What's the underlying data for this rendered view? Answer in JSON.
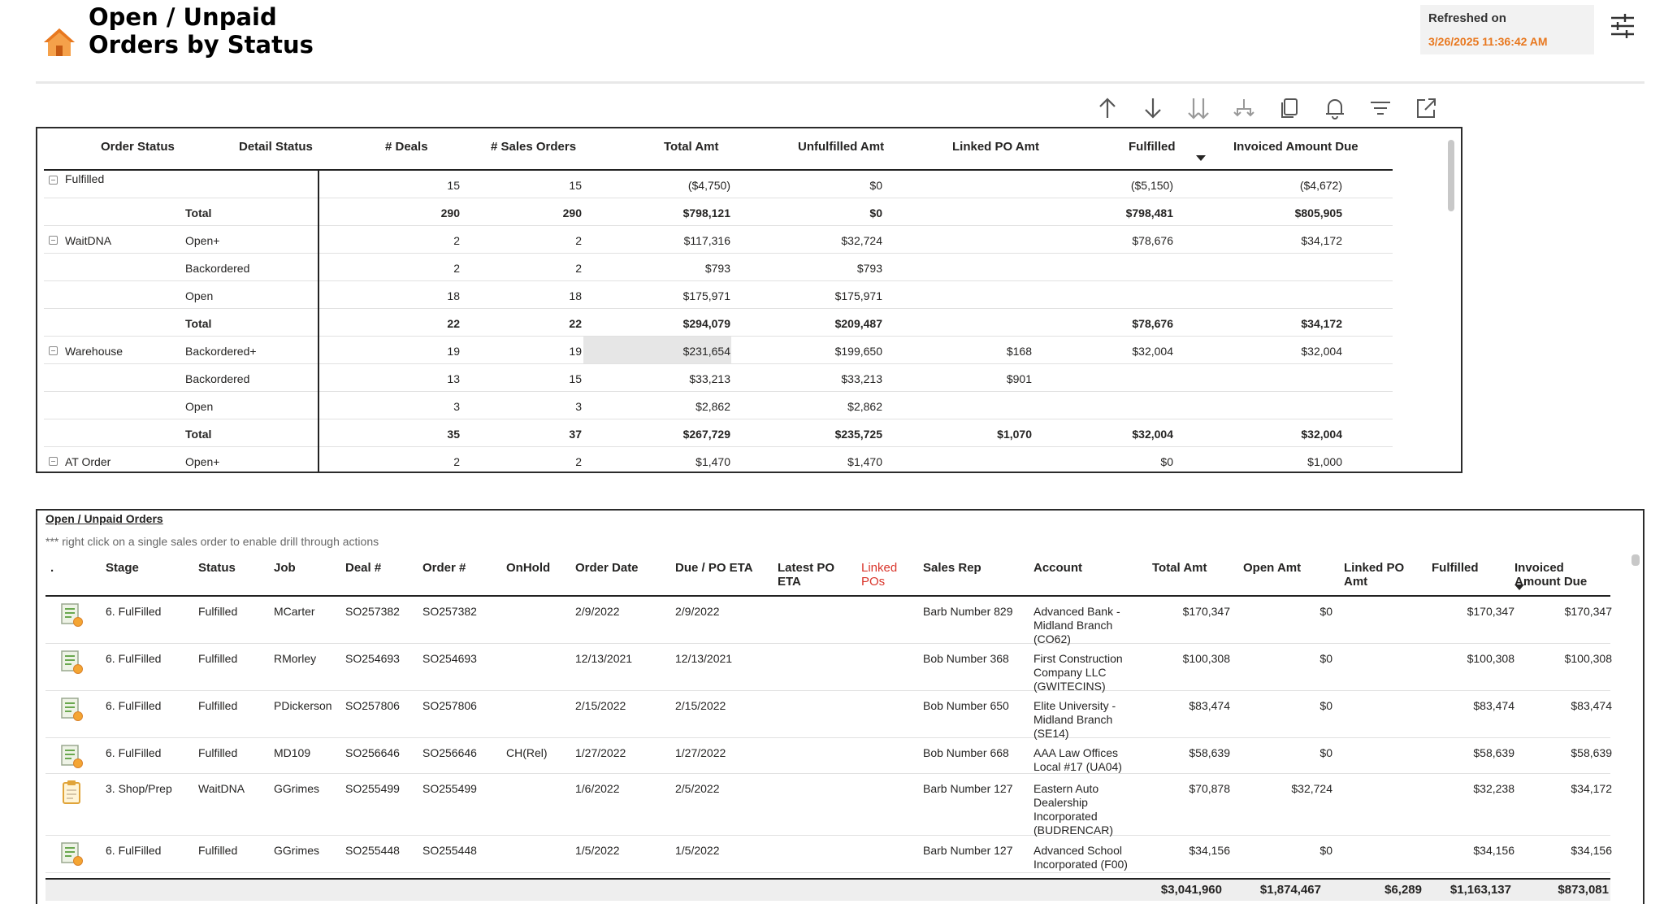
{
  "header": {
    "title_line1": "Open / Unpaid",
    "title_line2": "Orders by Status",
    "refreshed_label": "Refreshed on",
    "refreshed_value": "3/26/2025 11:36:42 AM",
    "accent_color": "#e8781f"
  },
  "toolbar": {
    "icons": [
      "sort-ascending-icon",
      "sort-descending-icon",
      "expand-all-icon",
      "drill-hierarchy-icon",
      "copy-icon",
      "bell-icon",
      "filter-icon",
      "focus-mode-icon"
    ]
  },
  "matrix": {
    "headers": [
      "Order Status",
      "Detail Status",
      "# Deals",
      "# Sales Orders",
      "Total Amt",
      "Unfulfilled Amt",
      "Linked PO Amt",
      "Fulfilled",
      "Invoiced Amount Due"
    ],
    "rows": [
      {
        "group": "Fulfilled",
        "detail": "",
        "deals": "15",
        "so": "15",
        "total": "($4,750)",
        "unfulfilled": "$0",
        "linked": "",
        "fulfilled": "($5,150)",
        "invoiced": "($4,672)",
        "bold": false
      },
      {
        "group": "",
        "detail": "Total",
        "deals": "290",
        "so": "290",
        "total": "$798,121",
        "unfulfilled": "$0",
        "linked": "",
        "fulfilled": "$798,481",
        "invoiced": "$805,905",
        "bold": true
      },
      {
        "group": "WaitDNA",
        "detail": "Open+",
        "deals": "2",
        "so": "2",
        "total": "$117,316",
        "unfulfilled": "$32,724",
        "linked": "",
        "fulfilled": "$78,676",
        "invoiced": "$34,172",
        "bold": false
      },
      {
        "group": "",
        "detail": "Backordered",
        "deals": "2",
        "so": "2",
        "total": "$793",
        "unfulfilled": "$793",
        "linked": "",
        "fulfilled": "",
        "invoiced": "",
        "bold": false
      },
      {
        "group": "",
        "detail": "Open",
        "deals": "18",
        "so": "18",
        "total": "$175,971",
        "unfulfilled": "$175,971",
        "linked": "",
        "fulfilled": "",
        "invoiced": "",
        "bold": false
      },
      {
        "group": "",
        "detail": "Total",
        "deals": "22",
        "so": "22",
        "total": "$294,079",
        "unfulfilled": "$209,487",
        "linked": "",
        "fulfilled": "$78,676",
        "invoiced": "$34,172",
        "bold": true
      },
      {
        "group": "Warehouse",
        "detail": "Backordered+",
        "deals": "19",
        "so": "19",
        "total": "$231,654",
        "unfulfilled": "$199,650",
        "linked": "$168",
        "fulfilled": "$32,004",
        "invoiced": "$32,004",
        "bold": false
      },
      {
        "group": "",
        "detail": "Backordered",
        "deals": "13",
        "so": "15",
        "total": "$33,213",
        "unfulfilled": "$33,213",
        "linked": "$901",
        "fulfilled": "",
        "invoiced": "",
        "bold": false
      },
      {
        "group": "",
        "detail": "Open",
        "deals": "3",
        "so": "3",
        "total": "$2,862",
        "unfulfilled": "$2,862",
        "linked": "",
        "fulfilled": "",
        "invoiced": "",
        "bold": false
      },
      {
        "group": "",
        "detail": "Total",
        "deals": "35",
        "so": "37",
        "total": "$267,729",
        "unfulfilled": "$235,725",
        "linked": "$1,070",
        "fulfilled": "$32,004",
        "invoiced": "$32,004",
        "bold": true
      },
      {
        "group": "AT Order",
        "detail": "Open+",
        "deals": "2",
        "so": "2",
        "total": "$1,470",
        "unfulfilled": "$1,470",
        "linked": "",
        "fulfilled": "$0",
        "invoiced": "$1,000",
        "bold": false
      }
    ]
  },
  "table": {
    "title": "Open / Unpaid Orders",
    "note": "*** right click on a single sales order to enable drill through actions",
    "first_header": ".",
    "headers": [
      "Stage",
      "Status",
      "Job",
      "Deal #",
      "Order #",
      "OnHold",
      "Order Date",
      "Due / PO ETA",
      "Latest PO ETA",
      "Linked POs",
      "Sales Rep",
      "Account",
      "Total Amt",
      "Open Amt",
      "Linked PO Amt",
      "Fulfilled",
      "Invoiced Amount Due"
    ],
    "linked_pos_color": "#d9352b",
    "rows": [
      {
        "icon": "fulfilled-report-icon",
        "stage": "6. FulFilled",
        "status": "Fulfilled",
        "job": "MCarter",
        "deal": "SO257382",
        "order": "SO257382",
        "onhold": "",
        "order_date": "2/9/2022",
        "due": "2/9/2022",
        "latest": "",
        "linked": "",
        "rep": "Barb Number 829",
        "account": "Advanced Bank - Midland Branch (CO62)",
        "total": "$170,347",
        "open": "$0",
        "linked_amt": "",
        "fulfilled": "$170,347",
        "invoiced": "$170,347"
      },
      {
        "icon": "fulfilled-report-icon",
        "stage": "6. FulFilled",
        "status": "Fulfilled",
        "job": "RMorley",
        "deal": "SO254693",
        "order": "SO254693",
        "onhold": "",
        "order_date": "12/13/2021",
        "due": "12/13/2021",
        "latest": "",
        "linked": "",
        "rep": "Bob Number 368",
        "account": "First Construction Company LLC (GWITECINS)",
        "total": "$100,308",
        "open": "$0",
        "linked_amt": "",
        "fulfilled": "$100,308",
        "invoiced": "$100,308"
      },
      {
        "icon": "fulfilled-report-icon",
        "stage": "6. FulFilled",
        "status": "Fulfilled",
        "job": "PDickerson",
        "deal": "SO257806",
        "order": "SO257806",
        "onhold": "",
        "order_date": "2/15/2022",
        "due": "2/15/2022",
        "latest": "",
        "linked": "",
        "rep": "Bob Number 650",
        "account": "Elite University - Midland Branch (SE14)",
        "total": "$83,474",
        "open": "$0",
        "linked_amt": "",
        "fulfilled": "$83,474",
        "invoiced": "$83,474"
      },
      {
        "icon": "fulfilled-report-icon",
        "stage": "6. FulFilled",
        "status": "Fulfilled",
        "job": "MD109",
        "deal": "SO256646",
        "order": "SO256646",
        "onhold": "CH(Rel)",
        "order_date": "1/27/2022",
        "due": "1/27/2022",
        "latest": "",
        "linked": "",
        "rep": "Bob Number 668",
        "account": "AAA Law Offices Local #17 (UA04)",
        "total": "$58,639",
        "open": "$0",
        "linked_amt": "",
        "fulfilled": "$58,639",
        "invoiced": "$58,639"
      },
      {
        "icon": "clipboard-icon",
        "stage": "3. Shop/Prep",
        "status": "WaitDNA",
        "job": "GGrimes",
        "deal": "SO255499",
        "order": "SO255499",
        "onhold": "",
        "order_date": "1/6/2022",
        "due": "2/5/2022",
        "latest": "",
        "linked": "",
        "rep": "Barb Number 127",
        "account": "Eastern Auto Dealership Incorporated (BUDRENCAR)",
        "total": "$70,878",
        "open": "$32,724",
        "linked_amt": "",
        "fulfilled": "$32,238",
        "invoiced": "$34,172"
      },
      {
        "icon": "fulfilled-report-icon",
        "stage": "6. FulFilled",
        "status": "Fulfilled",
        "job": "GGrimes",
        "deal": "SO255448",
        "order": "SO255448",
        "onhold": "",
        "order_date": "1/5/2022",
        "due": "1/5/2022",
        "latest": "",
        "linked": "",
        "rep": "Barb Number 127",
        "account": "Advanced School Incorporated (F00)",
        "total": "$34,156",
        "open": "$0",
        "linked_amt": "",
        "fulfilled": "$34,156",
        "invoiced": "$34,156"
      }
    ],
    "totals": {
      "total": "$3,041,960",
      "open": "$1,874,467",
      "linked_amt": "$6,289",
      "fulfilled": "$1,163,137",
      "invoiced": "$873,081"
    }
  }
}
